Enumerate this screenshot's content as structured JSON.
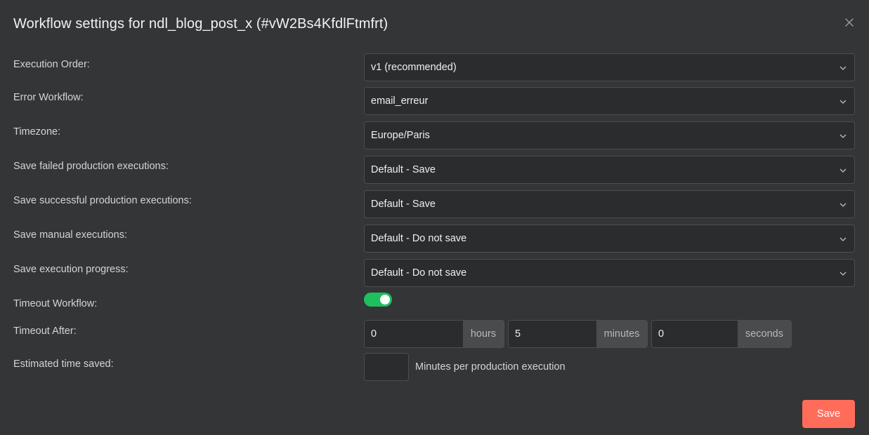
{
  "dialog": {
    "title": "Workflow settings for ndl_blog_post_x (#vW2Bs4KfdlFtmfrt)"
  },
  "fields": {
    "execution_order": {
      "label": "Execution Order:",
      "value": "v1 (recommended)"
    },
    "error_workflow": {
      "label": "Error Workflow:",
      "value": "email_erreur"
    },
    "timezone": {
      "label": "Timezone:",
      "value": "Europe/Paris"
    },
    "save_failed": {
      "label": "Save failed production executions:",
      "value": "Default - Save"
    },
    "save_successful": {
      "label": "Save successful production executions:",
      "value": "Default - Save"
    },
    "save_manual": {
      "label": "Save manual executions:",
      "value": "Default - Do not save"
    },
    "save_progress": {
      "label": "Save execution progress:",
      "value": "Default - Do not save"
    },
    "timeout_workflow": {
      "label": "Timeout Workflow:",
      "enabled": true
    },
    "timeout_after": {
      "label": "Timeout After:",
      "hours": "0",
      "hours_unit": "hours",
      "minutes": "5",
      "minutes_unit": "minutes",
      "seconds": "0",
      "seconds_unit": "seconds"
    },
    "estimated_time": {
      "label": "Estimated time saved:",
      "value": "",
      "suffix": "Minutes per production execution"
    }
  },
  "actions": {
    "save_label": "Save"
  },
  "colors": {
    "background": "#343536",
    "toggle_on": "#1fbf5f",
    "save_button": "#ff6d5a"
  },
  "icons": {
    "close": "close-icon",
    "dropdown": "chevron-down-icon"
  }
}
